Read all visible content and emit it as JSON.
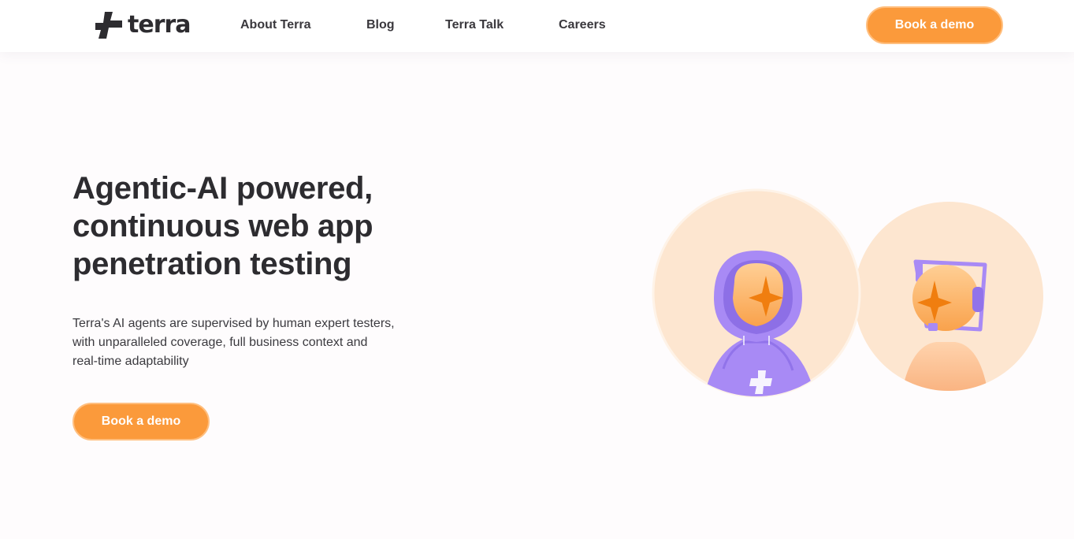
{
  "brand": {
    "name": "terra"
  },
  "nav": {
    "items": [
      {
        "label": "About Terra"
      },
      {
        "label": "Blog"
      },
      {
        "label": "Terra Talk"
      },
      {
        "label": "Careers"
      }
    ]
  },
  "header": {
    "cta_label": "Book a demo"
  },
  "hero": {
    "title_lines": [
      "Agentic-AI powered,",
      "continuous web app",
      "penetration testing"
    ],
    "description_lines": [
      "Terra's AI agents are supervised by human expert testers,",
      "with unparalleled coverage, full business context and",
      "real-time adaptability"
    ],
    "cta_label": "Book a demo"
  },
  "illustration": {
    "left_figure": "hooded-ai-agent",
    "right_figure": "human-tester-with-headset"
  },
  "colors": {
    "accent_orange": "#fb9a3b",
    "accent_purple": "#a88af5",
    "peach_bg": "#fde6d0",
    "text_dark": "#2d2c30"
  }
}
